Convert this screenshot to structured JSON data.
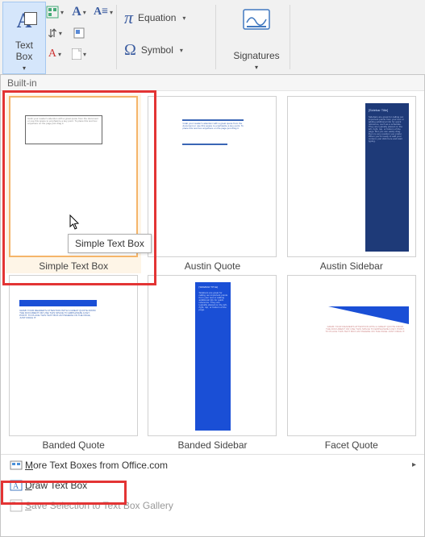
{
  "ribbon": {
    "textbox_icon": "A",
    "textbox_label": "Text\nBox",
    "equation_label": "Equation",
    "symbol_label": "Symbol",
    "signatures_label": "Signatures"
  },
  "gallery": {
    "header": "Built-in",
    "tooltip": "Simple Text Box",
    "items": [
      {
        "label": "Simple Text Box"
      },
      {
        "label": "Austin Quote"
      },
      {
        "label": "Austin Sidebar"
      },
      {
        "label": "Banded Quote"
      },
      {
        "label": "Banded Sidebar"
      },
      {
        "label": "Facet Quote"
      }
    ]
  },
  "menu": {
    "more": "More Text Boxes from Office.com",
    "draw": "Draw Text Box",
    "save": "Save Selection to Text Box Gallery"
  }
}
